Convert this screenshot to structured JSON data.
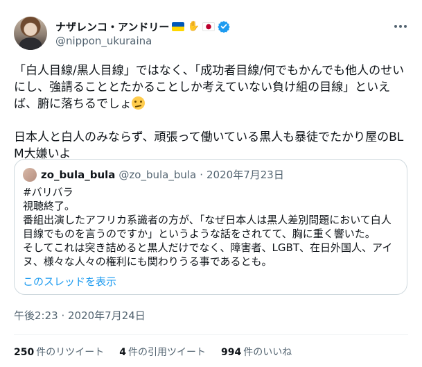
{
  "author": {
    "display_name": "ナザレンコ・アンドリー",
    "handle": "@nippon_ukuraina",
    "badges": [
      "ukraine-flag-icon",
      "handshake-icon",
      "japan-flag-icon",
      "verified-icon"
    ]
  },
  "tweet": {
    "paragraph1": "「白人目線/黒人目線」ではなく、「成功者目線/何でもかんでも他人のせいにし、強請ることとたかることしか考えていない負け組の目線」といえば、腑に落ちるでしょ",
    "paragraph1_emoji": "face-with-rolling-eyes-icon",
    "paragraph2": "日本人と白人のみならず、頑張って働いている黒人も暴徒でたかり屋のBLM大嫌いよ"
  },
  "quoted": {
    "display_name": "zo_bula_bula",
    "handle": "@zo_bula_bula",
    "separator": "·",
    "date": "2020年7月23日",
    "lines": [
      "#バリバラ",
      "視聴終了。",
      "番組出演したアフリカ系識者の方が、「なぜ日本人は黒人差別問題において白人",
      "目線でものを言うのですか」というような話をされてて、胸に重く響いた。",
      "そしてこれは突き詰めると黒人だけでなく、障害者、LGBT、在日外国人、アイ",
      "ヌ、様々な人々の権利にも関わりうる事であるとも。"
    ],
    "show_thread": "このスレッドを表示"
  },
  "timestamp": "午後2:23 · 2020年7月24日",
  "stats": {
    "retweets_count": "250",
    "retweets_label": "件のリツイート",
    "quotes_count": "4",
    "quotes_label": "件の引用ツイート",
    "likes_count": "994",
    "likes_label": "件のいいね"
  },
  "colors": {
    "text_primary": "#0f1419",
    "text_secondary": "#536471",
    "link": "#1d9bf0",
    "verified": "#1d9bf0",
    "border": "#cfd9de"
  }
}
